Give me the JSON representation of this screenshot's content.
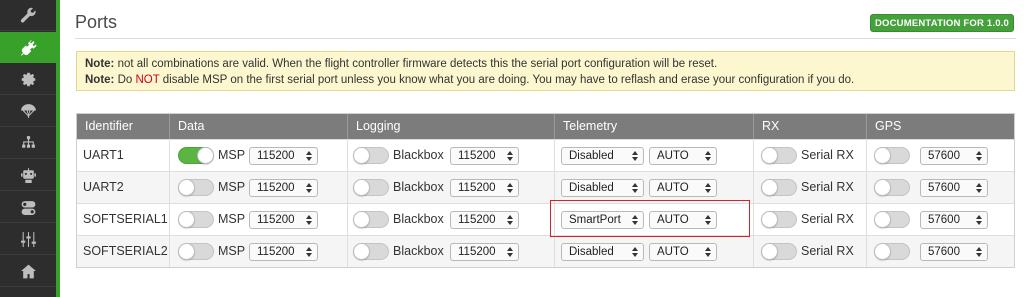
{
  "sidebar": {
    "items": [
      {
        "icon": "wrench-icon"
      },
      {
        "icon": "plug-icon",
        "active": true
      },
      {
        "icon": "gear-icon"
      },
      {
        "icon": "parachute-icon"
      },
      {
        "icon": "network-icon"
      },
      {
        "icon": "robot-icon"
      },
      {
        "icon": "toggle-icon"
      },
      {
        "icon": "sliders-icon"
      },
      {
        "icon": "home-icon"
      }
    ]
  },
  "header": {
    "title": "Ports",
    "doc_button": "DOCUMENTATION FOR 1.0.0"
  },
  "note": {
    "line1_label": "Note:",
    "line1_text": "not all combinations are valid. When the flight controller firmware detects this the serial port configuration will be reset.",
    "line2_label": "Note:",
    "line2_pre": "Do",
    "line2_not": "NOT",
    "line2_post": "disable MSP on the first serial port unless you know what you are doing. You may have to reflash and erase your configuration if you do."
  },
  "table": {
    "headers": [
      "Identifier",
      "Data",
      "Logging",
      "Telemetry",
      "RX",
      "GPS"
    ],
    "rows": [
      {
        "identifier": "UART1",
        "msp_on": true,
        "msp_label": "MSP",
        "msp_baud": "115200",
        "log_label": "Blackbox",
        "log_baud": "115200",
        "telemetry": "Disabled",
        "telemetry_baud": "AUTO",
        "rx_label": "Serial RX",
        "gps_baud": "57600"
      },
      {
        "identifier": "UART2",
        "msp_on": false,
        "msp_label": "MSP",
        "msp_baud": "115200",
        "log_label": "Blackbox",
        "log_baud": "115200",
        "telemetry": "Disabled",
        "telemetry_baud": "AUTO",
        "rx_label": "Serial RX",
        "gps_baud": "57600"
      },
      {
        "identifier": "SOFTSERIAL1",
        "msp_on": false,
        "msp_label": "MSP",
        "msp_baud": "115200",
        "log_label": "Blackbox",
        "log_baud": "115200",
        "telemetry": "SmartPort",
        "telemetry_baud": "AUTO",
        "rx_label": "Serial RX",
        "gps_baud": "57600"
      },
      {
        "identifier": "SOFTSERIAL2",
        "msp_on": false,
        "msp_label": "MSP",
        "msp_baud": "115200",
        "log_label": "Blackbox",
        "log_baud": "115200",
        "telemetry": "Disabled",
        "telemetry_baud": "AUTO",
        "rx_label": "Serial RX",
        "gps_baud": "57600"
      }
    ]
  },
  "colors": {
    "accent": "#37a12a",
    "sidebar": "#2d2d2d",
    "header": "#7c7c7c",
    "note_bg": "#fcf7cf",
    "highlight": "#d0242b"
  }
}
